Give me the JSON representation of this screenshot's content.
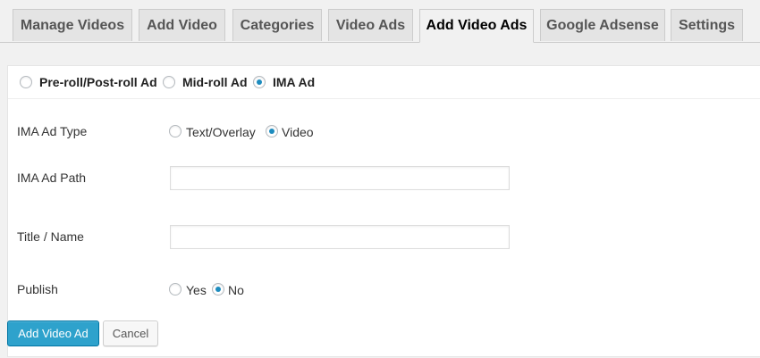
{
  "tabs": [
    {
      "label": "Manage Videos"
    },
    {
      "label": "Add Video"
    },
    {
      "label": "Categories"
    },
    {
      "label": "Video Ads"
    },
    {
      "label": "Add Video Ads",
      "active": true
    },
    {
      "label": "Google Adsense"
    },
    {
      "label": "Settings"
    }
  ],
  "ad_type": {
    "options": [
      {
        "label": "Pre-roll/Post-roll Ad",
        "checked": false
      },
      {
        "label": "Mid-roll Ad",
        "checked": false
      },
      {
        "label": "IMA Ad",
        "checked": true
      }
    ]
  },
  "form": {
    "ima_ad_type": {
      "label": "IMA Ad Type",
      "options": [
        {
          "label": "Text/Overlay",
          "checked": false
        },
        {
          "label": "Video",
          "checked": true
        }
      ]
    },
    "ima_ad_path": {
      "label": "IMA Ad Path",
      "value": ""
    },
    "title": {
      "label": "Title / Name",
      "value": ""
    },
    "publish": {
      "label": "Publish",
      "options": [
        {
          "label": "Yes",
          "checked": false
        },
        {
          "label": "No",
          "checked": true
        }
      ]
    }
  },
  "buttons": {
    "submit": "Add Video Ad",
    "cancel": "Cancel"
  },
  "colors": {
    "primary_button": "#2ea2cc",
    "radio_checked": "#1e8cbe"
  }
}
